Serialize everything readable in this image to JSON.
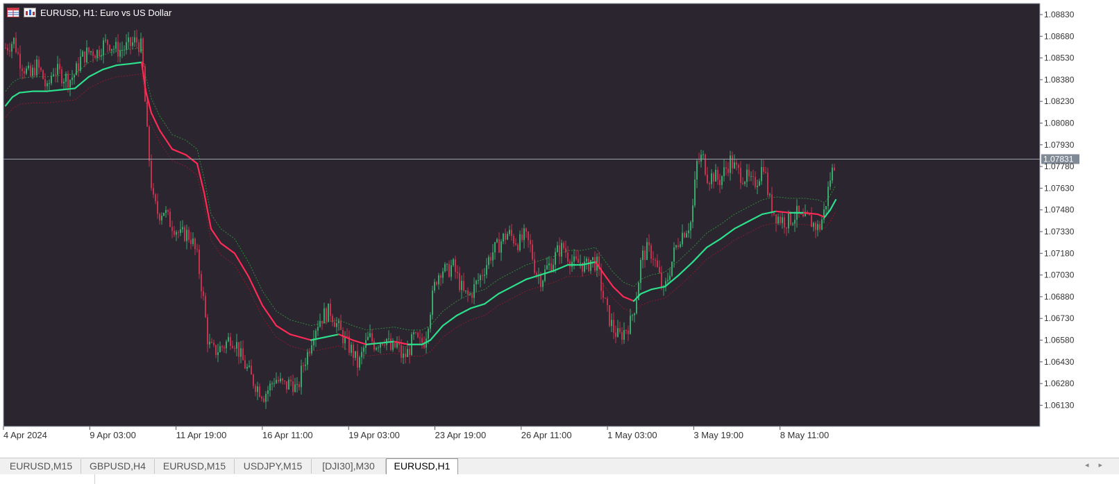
{
  "window": {
    "title": "EURUSD, H1:  Euro vs US Dollar",
    "icons": [
      "table-icon",
      "chart-icon"
    ],
    "colors": {
      "background": "#2b2530",
      "axis_bg": "#ffffff",
      "bull": "#3aa86b",
      "bear": "#c2334d",
      "ma_up": "#2de08c",
      "ma_down": "#ff2a55",
      "band_upper": "#2e8b3a",
      "band_lower": "#8b1a2c",
      "price_line": "#9aa3ad",
      "price_tag_bg": "#808a96"
    }
  },
  "tabs": [
    {
      "label": "EURUSD,M15",
      "active": false
    },
    {
      "label": "GBPUSD,H4",
      "active": false
    },
    {
      "label": "EURUSD,M15",
      "active": false
    },
    {
      "label": "USDJPY,M15",
      "active": false
    },
    {
      "label": "[DJI30],M30",
      "active": false
    },
    {
      "label": "EURUSD,H1",
      "active": true
    }
  ],
  "tab_scroll": {
    "left": "◂",
    "right": "▸"
  },
  "chart_data": {
    "type": "candlestick",
    "symbol": "EURUSD",
    "timeframe": "H1",
    "y_ticks": [
      "1.08830",
      "1.08680",
      "1.08530",
      "1.08380",
      "1.08230",
      "1.08080",
      "1.07930",
      "1.07780",
      "1.07630",
      "1.07480",
      "1.07330",
      "1.07180",
      "1.07030",
      "1.06880",
      "1.06730",
      "1.06580",
      "1.06430",
      "1.06280",
      "1.06130"
    ],
    "x_ticks": [
      "4 Apr 2024",
      "9 Apr 03:00",
      "11 Apr 19:00",
      "16 Apr 11:00",
      "19 Apr 03:00",
      "23 Apr 19:00",
      "26 Apr 11:00",
      "1 May 03:00",
      "3 May 19:00",
      "8 May 11:00"
    ],
    "ylim": [
      1.0605,
      1.089
    ],
    "current_price": "1.07831",
    "grid": false,
    "price_path": [
      [
        0,
        1.086
      ],
      [
        12,
        1.0865
      ],
      [
        20,
        1.0852
      ],
      [
        28,
        1.0845
      ],
      [
        36,
        1.084
      ],
      [
        44,
        1.0848
      ],
      [
        52,
        1.0842
      ],
      [
        60,
        1.083
      ],
      [
        68,
        1.0845
      ],
      [
        76,
        1.0843
      ],
      [
        84,
        1.084
      ],
      [
        92,
        1.0838
      ],
      [
        100,
        1.0842
      ],
      [
        108,
        1.0852
      ],
      [
        116,
        1.0856
      ],
      [
        124,
        1.0858
      ],
      [
        132,
        1.0857
      ],
      [
        140,
        1.0862
      ],
      [
        148,
        1.0864
      ],
      [
        156,
        1.086
      ],
      [
        164,
        1.0858
      ],
      [
        172,
        1.086
      ],
      [
        180,
        1.0862
      ],
      [
        188,
        1.0865
      ],
      [
        196,
        1.086
      ],
      [
        204,
        1.08
      ],
      [
        212,
        1.0755
      ],
      [
        220,
        1.0745
      ],
      [
        228,
        1.0748
      ],
      [
        236,
        1.074
      ],
      [
        244,
        1.0736
      ],
      [
        252,
        1.073
      ],
      [
        260,
        1.0732
      ],
      [
        268,
        1.0728
      ],
      [
        276,
        1.0715
      ],
      [
        284,
        1.069
      ],
      [
        292,
        1.0655
      ],
      [
        300,
        1.065
      ],
      [
        308,
        1.0652
      ],
      [
        316,
        1.0655
      ],
      [
        324,
        1.066
      ],
      [
        332,
        1.0656
      ],
      [
        340,
        1.0645
      ],
      [
        348,
        1.0638
      ],
      [
        356,
        1.063
      ],
      [
        364,
        1.0625
      ],
      [
        372,
        1.062
      ],
      [
        380,
        1.0625
      ],
      [
        388,
        1.0632
      ],
      [
        396,
        1.0628
      ],
      [
        404,
        1.0626
      ],
      [
        412,
        1.063
      ],
      [
        420,
        1.0622
      ],
      [
        428,
        1.064
      ],
      [
        436,
        1.065
      ],
      [
        444,
        1.0665
      ],
      [
        452,
        1.0672
      ],
      [
        460,
        1.0676
      ],
      [
        468,
        1.0678
      ],
      [
        476,
        1.067
      ],
      [
        484,
        1.0662
      ],
      [
        492,
        1.0655
      ],
      [
        500,
        1.065
      ],
      [
        508,
        1.064
      ],
      [
        516,
        1.0652
      ],
      [
        524,
        1.066
      ],
      [
        532,
        1.0655
      ],
      [
        540,
        1.0658
      ],
      [
        548,
        1.066
      ],
      [
        556,
        1.065
      ],
      [
        564,
        1.0655
      ],
      [
        572,
        1.0645
      ],
      [
        580,
        1.065
      ],
      [
        588,
        1.066
      ],
      [
        596,
        1.0655
      ],
      [
        604,
        1.0658
      ],
      [
        612,
        1.068
      ],
      [
        620,
        1.07
      ],
      [
        628,
        1.0708
      ],
      [
        636,
        1.0705
      ],
      [
        644,
        1.071
      ],
      [
        652,
        1.07
      ],
      [
        660,
        1.069
      ],
      [
        668,
        1.0688
      ],
      [
        676,
        1.0695
      ],
      [
        684,
        1.0702
      ],
      [
        692,
        1.071
      ],
      [
        700,
        1.0718
      ],
      [
        708,
        1.0722
      ],
      [
        716,
        1.0728
      ],
      [
        724,
        1.0732
      ],
      [
        732,
        1.0728
      ],
      [
        740,
        1.0725
      ],
      [
        748,
        1.073
      ],
      [
        756,
        1.0722
      ],
      [
        764,
        1.0705
      ],
      [
        772,
        1.07
      ],
      [
        780,
        1.0708
      ],
      [
        788,
        1.0712
      ],
      [
        796,
        1.072
      ],
      [
        804,
        1.0722
      ],
      [
        812,
        1.0715
      ],
      [
        820,
        1.071
      ],
      [
        828,
        1.0712
      ],
      [
        836,
        1.0708
      ],
      [
        844,
        1.0714
      ],
      [
        852,
        1.071
      ],
      [
        860,
        1.069
      ],
      [
        868,
        1.0675
      ],
      [
        876,
        1.0665
      ],
      [
        884,
        1.066
      ],
      [
        892,
        1.0665
      ],
      [
        900,
        1.067
      ],
      [
        908,
        1.0685
      ],
      [
        916,
        1.0715
      ],
      [
        924,
        1.072
      ],
      [
        932,
        1.0718
      ],
      [
        940,
        1.0705
      ],
      [
        948,
        1.069
      ],
      [
        956,
        1.0705
      ],
      [
        964,
        1.072
      ],
      [
        972,
        1.073
      ],
      [
        980,
        1.0735
      ],
      [
        988,
        1.074
      ],
      [
        996,
        1.078
      ],
      [
        1004,
        1.0785
      ],
      [
        1012,
        1.077
      ],
      [
        1020,
        1.0772
      ],
      [
        1028,
        1.0768
      ],
      [
        1036,
        1.0775
      ],
      [
        1044,
        1.0782
      ],
      [
        1052,
        1.0776
      ],
      [
        1060,
        1.0772
      ],
      [
        1068,
        1.077
      ],
      [
        1076,
        1.0765
      ],
      [
        1084,
        1.077
      ],
      [
        1092,
        1.078
      ],
      [
        1100,
        1.0755
      ],
      [
        1108,
        1.0745
      ],
      [
        1116,
        1.0742
      ],
      [
        1124,
        1.074
      ],
      [
        1132,
        1.0742
      ],
      [
        1140,
        1.0745
      ],
      [
        1148,
        1.074
      ],
      [
        1156,
        1.0742
      ],
      [
        1164,
        1.0738
      ],
      [
        1172,
        1.0735
      ],
      [
        1180,
        1.0748
      ],
      [
        1188,
        1.077
      ],
      [
        1196,
        1.0783
      ]
    ],
    "ma_path": [
      [
        0,
        1.082
      ],
      [
        10,
        1.0826
      ],
      [
        20,
        1.0829
      ],
      [
        40,
        1.083
      ],
      [
        60,
        1.083
      ],
      [
        80,
        1.0831
      ],
      [
        100,
        1.0832
      ],
      [
        120,
        1.084
      ],
      [
        140,
        1.0845
      ],
      [
        160,
        1.0848
      ],
      [
        180,
        1.0849
      ],
      [
        196,
        1.085
      ],
      [
        202,
        1.083
      ],
      [
        210,
        1.0815
      ],
      [
        222,
        1.0803
      ],
      [
        240,
        1.079
      ],
      [
        260,
        1.0786
      ],
      [
        276,
        1.078
      ],
      [
        286,
        1.076
      ],
      [
        296,
        1.0735
      ],
      [
        310,
        1.0725
      ],
      [
        330,
        1.0718
      ],
      [
        350,
        1.0702
      ],
      [
        370,
        1.0682
      ],
      [
        390,
        1.0668
      ],
      [
        410,
        1.0662
      ],
      [
        440,
        1.0658
      ],
      [
        460,
        1.066
      ],
      [
        480,
        1.0662
      ],
      [
        500,
        1.0658
      ],
      [
        520,
        1.0655
      ],
      [
        540,
        1.0656
      ],
      [
        560,
        1.0657
      ],
      [
        580,
        1.0655
      ],
      [
        600,
        1.0655
      ],
      [
        612,
        1.0658
      ],
      [
        630,
        1.0668
      ],
      [
        650,
        1.0675
      ],
      [
        670,
        1.068
      ],
      [
        690,
        1.0683
      ],
      [
        710,
        1.069
      ],
      [
        730,
        1.0695
      ],
      [
        750,
        1.07
      ],
      [
        770,
        1.0703
      ],
      [
        790,
        1.0706
      ],
      [
        810,
        1.071
      ],
      [
        830,
        1.071
      ],
      [
        850,
        1.0712
      ],
      [
        860,
        1.0705
      ],
      [
        875,
        1.0695
      ],
      [
        890,
        1.0688
      ],
      [
        905,
        1.0685
      ],
      [
        915,
        1.069
      ],
      [
        930,
        1.0693
      ],
      [
        950,
        1.0695
      ],
      [
        970,
        1.0703
      ],
      [
        990,
        1.0712
      ],
      [
        1010,
        1.0722
      ],
      [
        1030,
        1.0728
      ],
      [
        1050,
        1.0735
      ],
      [
        1070,
        1.074
      ],
      [
        1090,
        1.0745
      ],
      [
        1110,
        1.0747
      ],
      [
        1130,
        1.0746
      ],
      [
        1150,
        1.0746
      ],
      [
        1170,
        1.0745
      ],
      [
        1180,
        1.0743
      ],
      [
        1188,
        1.0748
      ],
      [
        1196,
        1.0755
      ]
    ]
  }
}
